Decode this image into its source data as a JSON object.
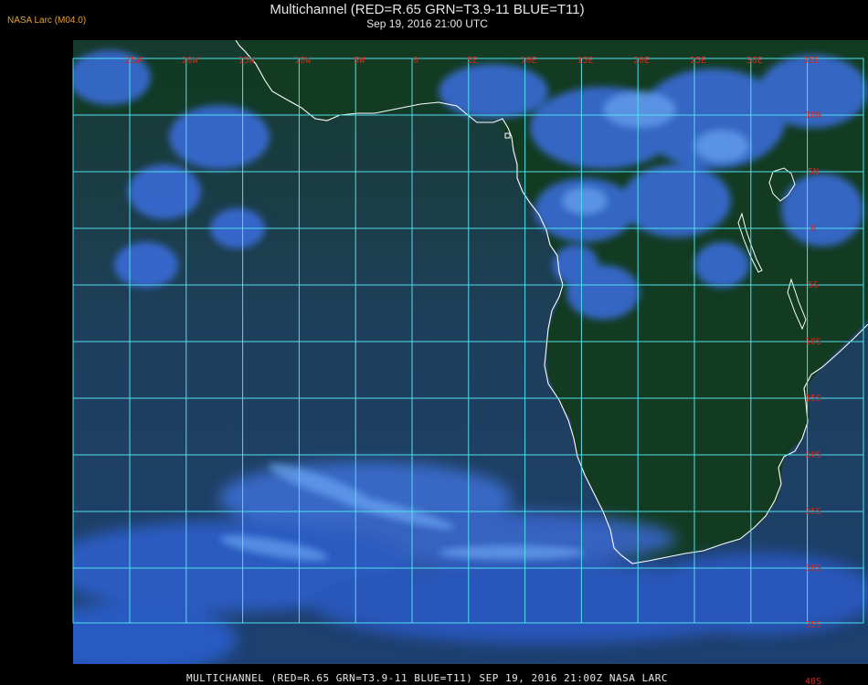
{
  "badge": "NASA Larc (M04.0)",
  "title_line1": "Multichannel (RED=R.65 GRN=T3.9-11 BLUE=T11)",
  "title_line2": "Sep 19, 2016 21:00 UTC",
  "footer": "MULTICHANNEL (RED=R.65 GRN=T3.9-11 BLUE=T11) SEP 19, 2016 21:00Z   NASA LARC",
  "grid": {
    "lon_labels": [
      "25W",
      "20W",
      "15W",
      "10W",
      "5W",
      "0",
      "5E",
      "10E",
      "15E",
      "20E",
      "25E",
      "30E",
      "35E"
    ],
    "lat_labels": [
      "10N",
      "5N",
      "0",
      "5S",
      "10S",
      "15S",
      "20S",
      "25S",
      "30S",
      "35S",
      "40S"
    ],
    "grid_color": "#4fe0ec",
    "label_color": "#d2281e"
  },
  "colors": {
    "ocean": "#1e3f5a",
    "land": "#123a22",
    "cloud": "#3a6ee0",
    "cloud_bright": "#7ab8ff",
    "coast": "#ffffff"
  }
}
